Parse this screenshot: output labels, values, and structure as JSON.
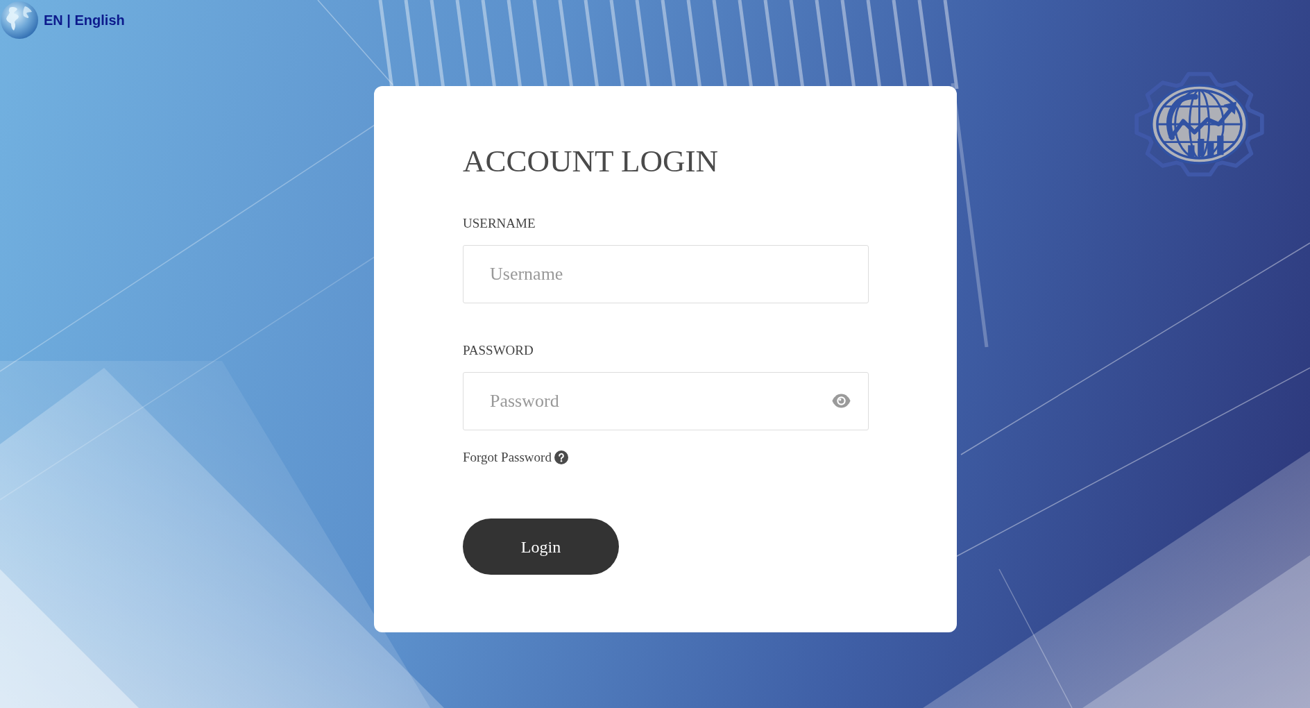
{
  "language_switch": {
    "label": "EN | English"
  },
  "login_form": {
    "title": "ACCOUNT LOGIN",
    "fields": [
      {
        "kind": "text",
        "label": "USERNAME",
        "placeholder": "Username"
      },
      {
        "kind": "password",
        "label": "PASSWORD",
        "placeholder": "Password"
      }
    ],
    "forgot_link": "Forgot Password",
    "submit": "Login"
  }
}
